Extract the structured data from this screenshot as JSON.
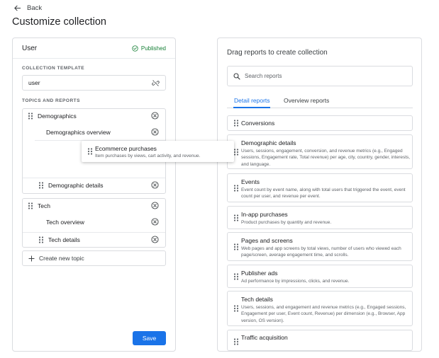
{
  "header": {
    "back_label": "Back",
    "title": "Customize collection"
  },
  "left": {
    "user_title": "User",
    "status": "Published",
    "template_label": "COLLECTION TEMPLATE",
    "template_value": "user",
    "topics_label": "TOPICS AND REPORTS",
    "topics": [
      {
        "name": "Demographics",
        "reports": [
          "Demographics overview",
          "Demographic details"
        ]
      },
      {
        "name": "Tech",
        "reports": [
          "Tech overview",
          "Tech details"
        ]
      }
    ],
    "create_topic": "Create new topic",
    "save": "Save"
  },
  "right": {
    "title": "Drag reports to create collection",
    "search_placeholder": "Search reports",
    "tabs": [
      "Detail reports",
      "Overview reports"
    ],
    "reports": [
      {
        "title": "Conversions",
        "desc": ""
      },
      {
        "title": "Demographic details",
        "desc": "Users, sessions, engagement, conversion, and revenue metrics (e.g., Engaged sessions, Engagement rate, Total revenue) per age, city, country, gender, interests, and language."
      },
      {
        "title": "Events",
        "desc": "Event count by event name, along with total users that triggered the event, event count per user, and revenue per event."
      },
      {
        "title": "In-app purchases",
        "desc": "Product purchases by quantity and revenue."
      },
      {
        "title": "Pages and screens",
        "desc": "Web pages and app screens by total views, number of users who viewed each page/screen, average engagement time, and scrolls."
      },
      {
        "title": "Publisher ads",
        "desc": "Ad performance by impressions, clicks, and revenue."
      },
      {
        "title": "Tech details",
        "desc": "Users, sessions, and engagement and revenue metrics (e.g., Engaged sessions, Engagement per user, Event count, Revenue) per dimension (e.g., Browser, App version, OS version)."
      },
      {
        "title": "Traffic acquisition",
        "desc": ""
      }
    ]
  },
  "drag_ghost": {
    "title": "Ecommerce purchases",
    "desc": "Item purchases by views, cart activity, and revenue."
  },
  "colors": {
    "accent": "#1a73e8",
    "published": "#188038",
    "border": "#dadce0"
  }
}
